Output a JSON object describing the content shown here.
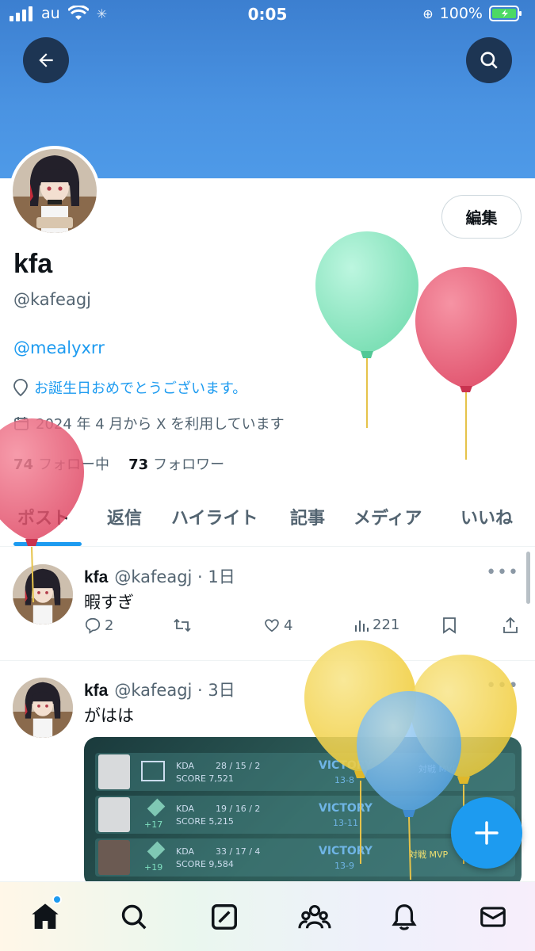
{
  "status": {
    "carrier": "au",
    "time": "0:05",
    "battery": "100%"
  },
  "profile": {
    "name": "kfa",
    "handle": "@kafeagj",
    "mention": "@mealyxrr",
    "location": "お誕生日おめでとうございます。",
    "joined": "2024 年 4 月から X を利用しています",
    "following_count": "74",
    "following_label": "フォロー中",
    "followers_count": "73",
    "followers_label": "フォロワー",
    "edit_label": "編集"
  },
  "tabs": [
    {
      "label": "ポスト"
    },
    {
      "label": "返信"
    },
    {
      "label": "ハイライト"
    },
    {
      "label": "記事"
    },
    {
      "label": "メディア"
    },
    {
      "label": "いいね"
    }
  ],
  "posts": [
    {
      "name": "kfa",
      "meta": "@kafeagj · 1日",
      "text": "暇すぎ",
      "replies": "2",
      "likes": "4",
      "views": "221"
    },
    {
      "name": "kfa",
      "meta": "@kafeagj · 3日",
      "text": "がはは"
    }
  ],
  "media_rows": [
    {
      "kda": "KDA",
      "kda_val": "28 / 15 / 2",
      "score": "SCORE 7,521",
      "result": "VICTORY",
      "sub": "13-8",
      "tag": "対戦 MVP"
    },
    {
      "kda": "KDA",
      "kda_val": "19 / 16 / 2",
      "score": "SCORE 5,215",
      "result": "VICTORY",
      "sub": "13-11",
      "rank": "+17"
    },
    {
      "kda": "KDA",
      "kda_val": "33 / 17 / 4",
      "score": "SCORE 9,584",
      "result": "VICTORY",
      "sub": "13-9",
      "tag": "対戦 MVP",
      "rank": "+19"
    }
  ],
  "colors": {
    "accent": "#1d9bf0",
    "banner": "#4a93e2",
    "text": "#0f1419",
    "muted": "#536471"
  }
}
